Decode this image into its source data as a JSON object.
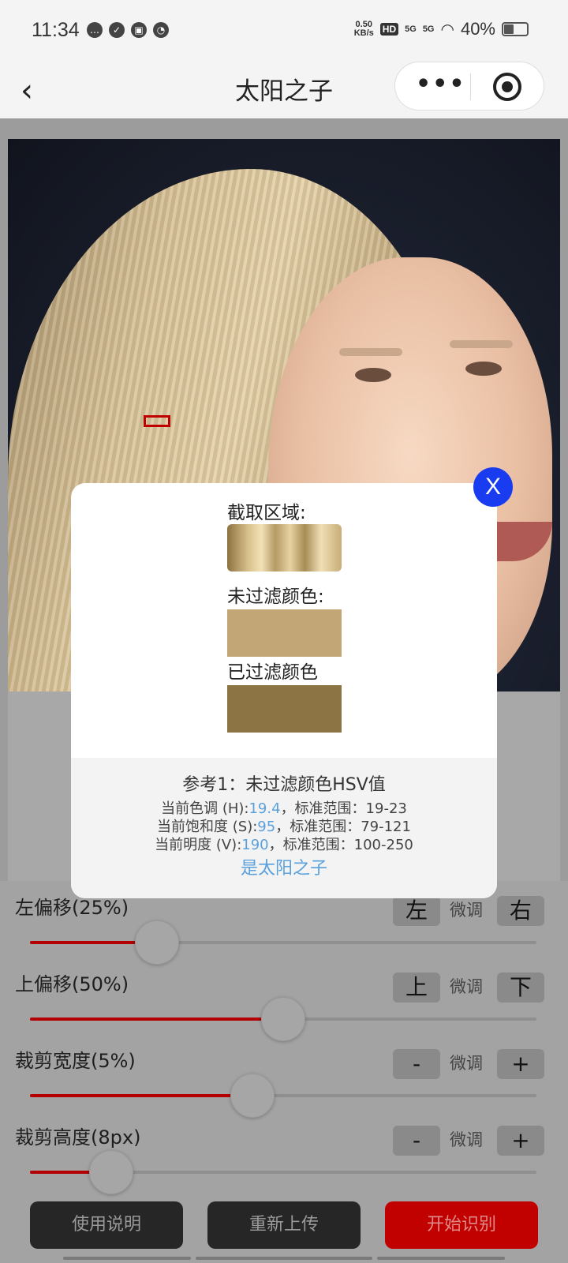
{
  "status_bar": {
    "time": "11:34",
    "net_speed_value": "0.50",
    "net_speed_unit": "KB/s",
    "hd": "HD",
    "signal1": "5G",
    "signal2": "5G",
    "battery": "40%",
    "battery_level": 0.4
  },
  "nav": {
    "back": "‹",
    "title": "太阳之子",
    "more": "•••"
  },
  "controls": {
    "left_offset": {
      "label": "左偏移(25%)",
      "btn_a": "左",
      "fine": "微调",
      "btn_b": "右",
      "value": 0.25
    },
    "top_offset": {
      "label": "上偏移(50%)",
      "btn_a": "上",
      "fine": "微调",
      "btn_b": "下",
      "value": 0.5
    },
    "crop_width": {
      "label": "裁剪宽度(5%)",
      "btn_a": "-",
      "fine": "微调",
      "btn_b": "+",
      "value": 0.44
    },
    "crop_height": {
      "label": "裁剪高度(8px)",
      "btn_a": "-",
      "fine": "微调",
      "btn_b": "+",
      "value": 0.16
    }
  },
  "buttons": {
    "help": "使用说明",
    "reupload": "重新上传",
    "start": "开始识别"
  },
  "modal": {
    "close": "X",
    "crop_label": "截取区域:",
    "raw_label": "未过滤颜色:",
    "filtered_label": "已过滤颜色",
    "raw_color": "#c2a676",
    "filtered_color": "#8c7445",
    "ref_title": "参考1：未过滤颜色HSV值",
    "hue_prefix": "当前色调 (H):",
    "hue_value": "19.4",
    "hue_suffix": "，标准范围：19-23",
    "sat_prefix": "当前饱和度 (S):",
    "sat_value": "95",
    "sat_suffix": "，标准范围：79-121",
    "val_prefix": "当前明度 (V):",
    "val_value": "190",
    "val_suffix": "，标准范围：100-250",
    "result": "是太阳之子"
  }
}
